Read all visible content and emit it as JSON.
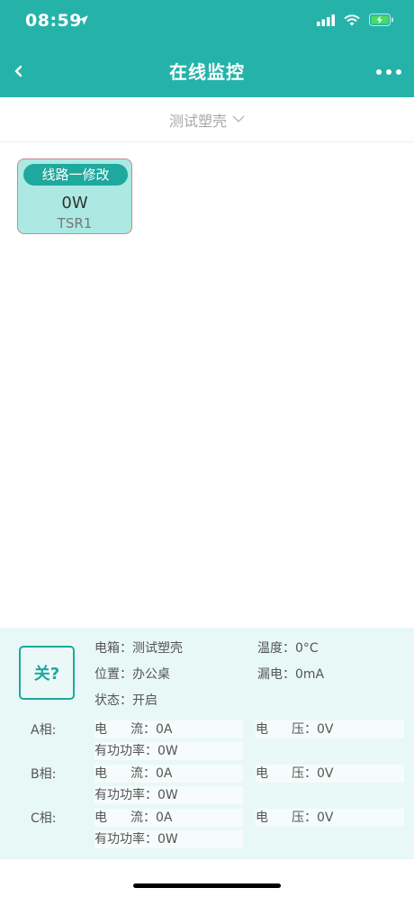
{
  "status": {
    "time": "08:59"
  },
  "nav": {
    "title": "在线监控"
  },
  "selector": {
    "value": "测试塑壳"
  },
  "circuit": {
    "label": "线路一修改",
    "power": "0W",
    "code": "TSR1"
  },
  "panel": {
    "switch_label": "关?",
    "box_label": "电箱：",
    "box_value": "测试塑壳",
    "temp_label": "温度：",
    "temp_value": "0°C",
    "location_label": "位置：",
    "location_value": "办公桌",
    "leak_label": "漏电：",
    "leak_value": "0mA",
    "state_label": "状态：",
    "state_value": "开启",
    "current_label_a": "电",
    "current_label_b": "流：",
    "voltage_label_a": "电",
    "voltage_label_b": "压：",
    "power_label": "有功功率：",
    "phases": [
      {
        "name": "A相:",
        "current": "0A",
        "voltage": "0V",
        "power": "0W"
      },
      {
        "name": "B相:",
        "current": "0A",
        "voltage": "0V",
        "power": "0W"
      },
      {
        "name": "C相:",
        "current": "0A",
        "voltage": "0V",
        "power": "0W"
      }
    ]
  },
  "colors": {
    "primary": "#25b3a9",
    "card_bg": "#ace9e3",
    "panel_bg": "#e8f8f6"
  }
}
